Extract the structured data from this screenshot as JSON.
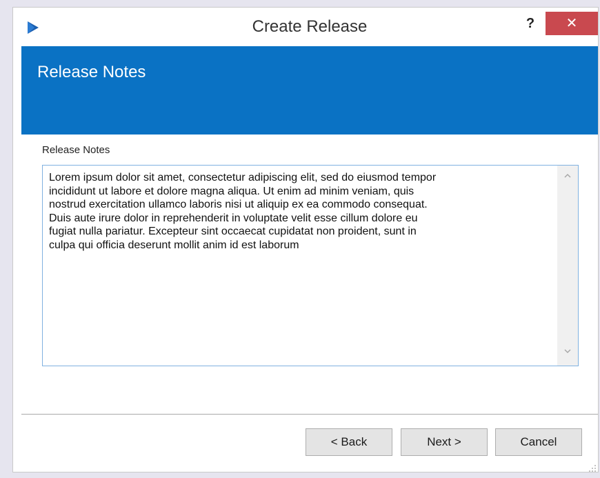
{
  "window": {
    "title": "Create Release",
    "help_label": "?",
    "close_label": "✕",
    "logo_icon": "app-logo-icon"
  },
  "banner": {
    "title": "Release Notes",
    "color": "#0a72c4"
  },
  "form": {
    "field_label": "Release Notes",
    "notes_value": "Lorem ipsum dolor sit amet, consectetur adipiscing elit, sed do eiusmod tempor\nincididunt ut labore et dolore magna aliqua. Ut enim ad minim veniam, quis\nnostrud exercitation ullamco laboris nisi ut aliquip ex ea commodo consequat.\nDuis aute irure dolor in reprehenderit in voluptate velit esse cillum dolore eu\nfugiat nulla pariatur. Excepteur sint occaecat cupidatat non proident, sunt in\nculpa qui officia deserunt mollit anim id est laborum"
  },
  "buttons": {
    "back_label": "< Back",
    "next_label": "Next >",
    "cancel_label": "Cancel"
  },
  "colors": {
    "close_button": "#c9494f",
    "textarea_border": "#7fb1e0"
  }
}
